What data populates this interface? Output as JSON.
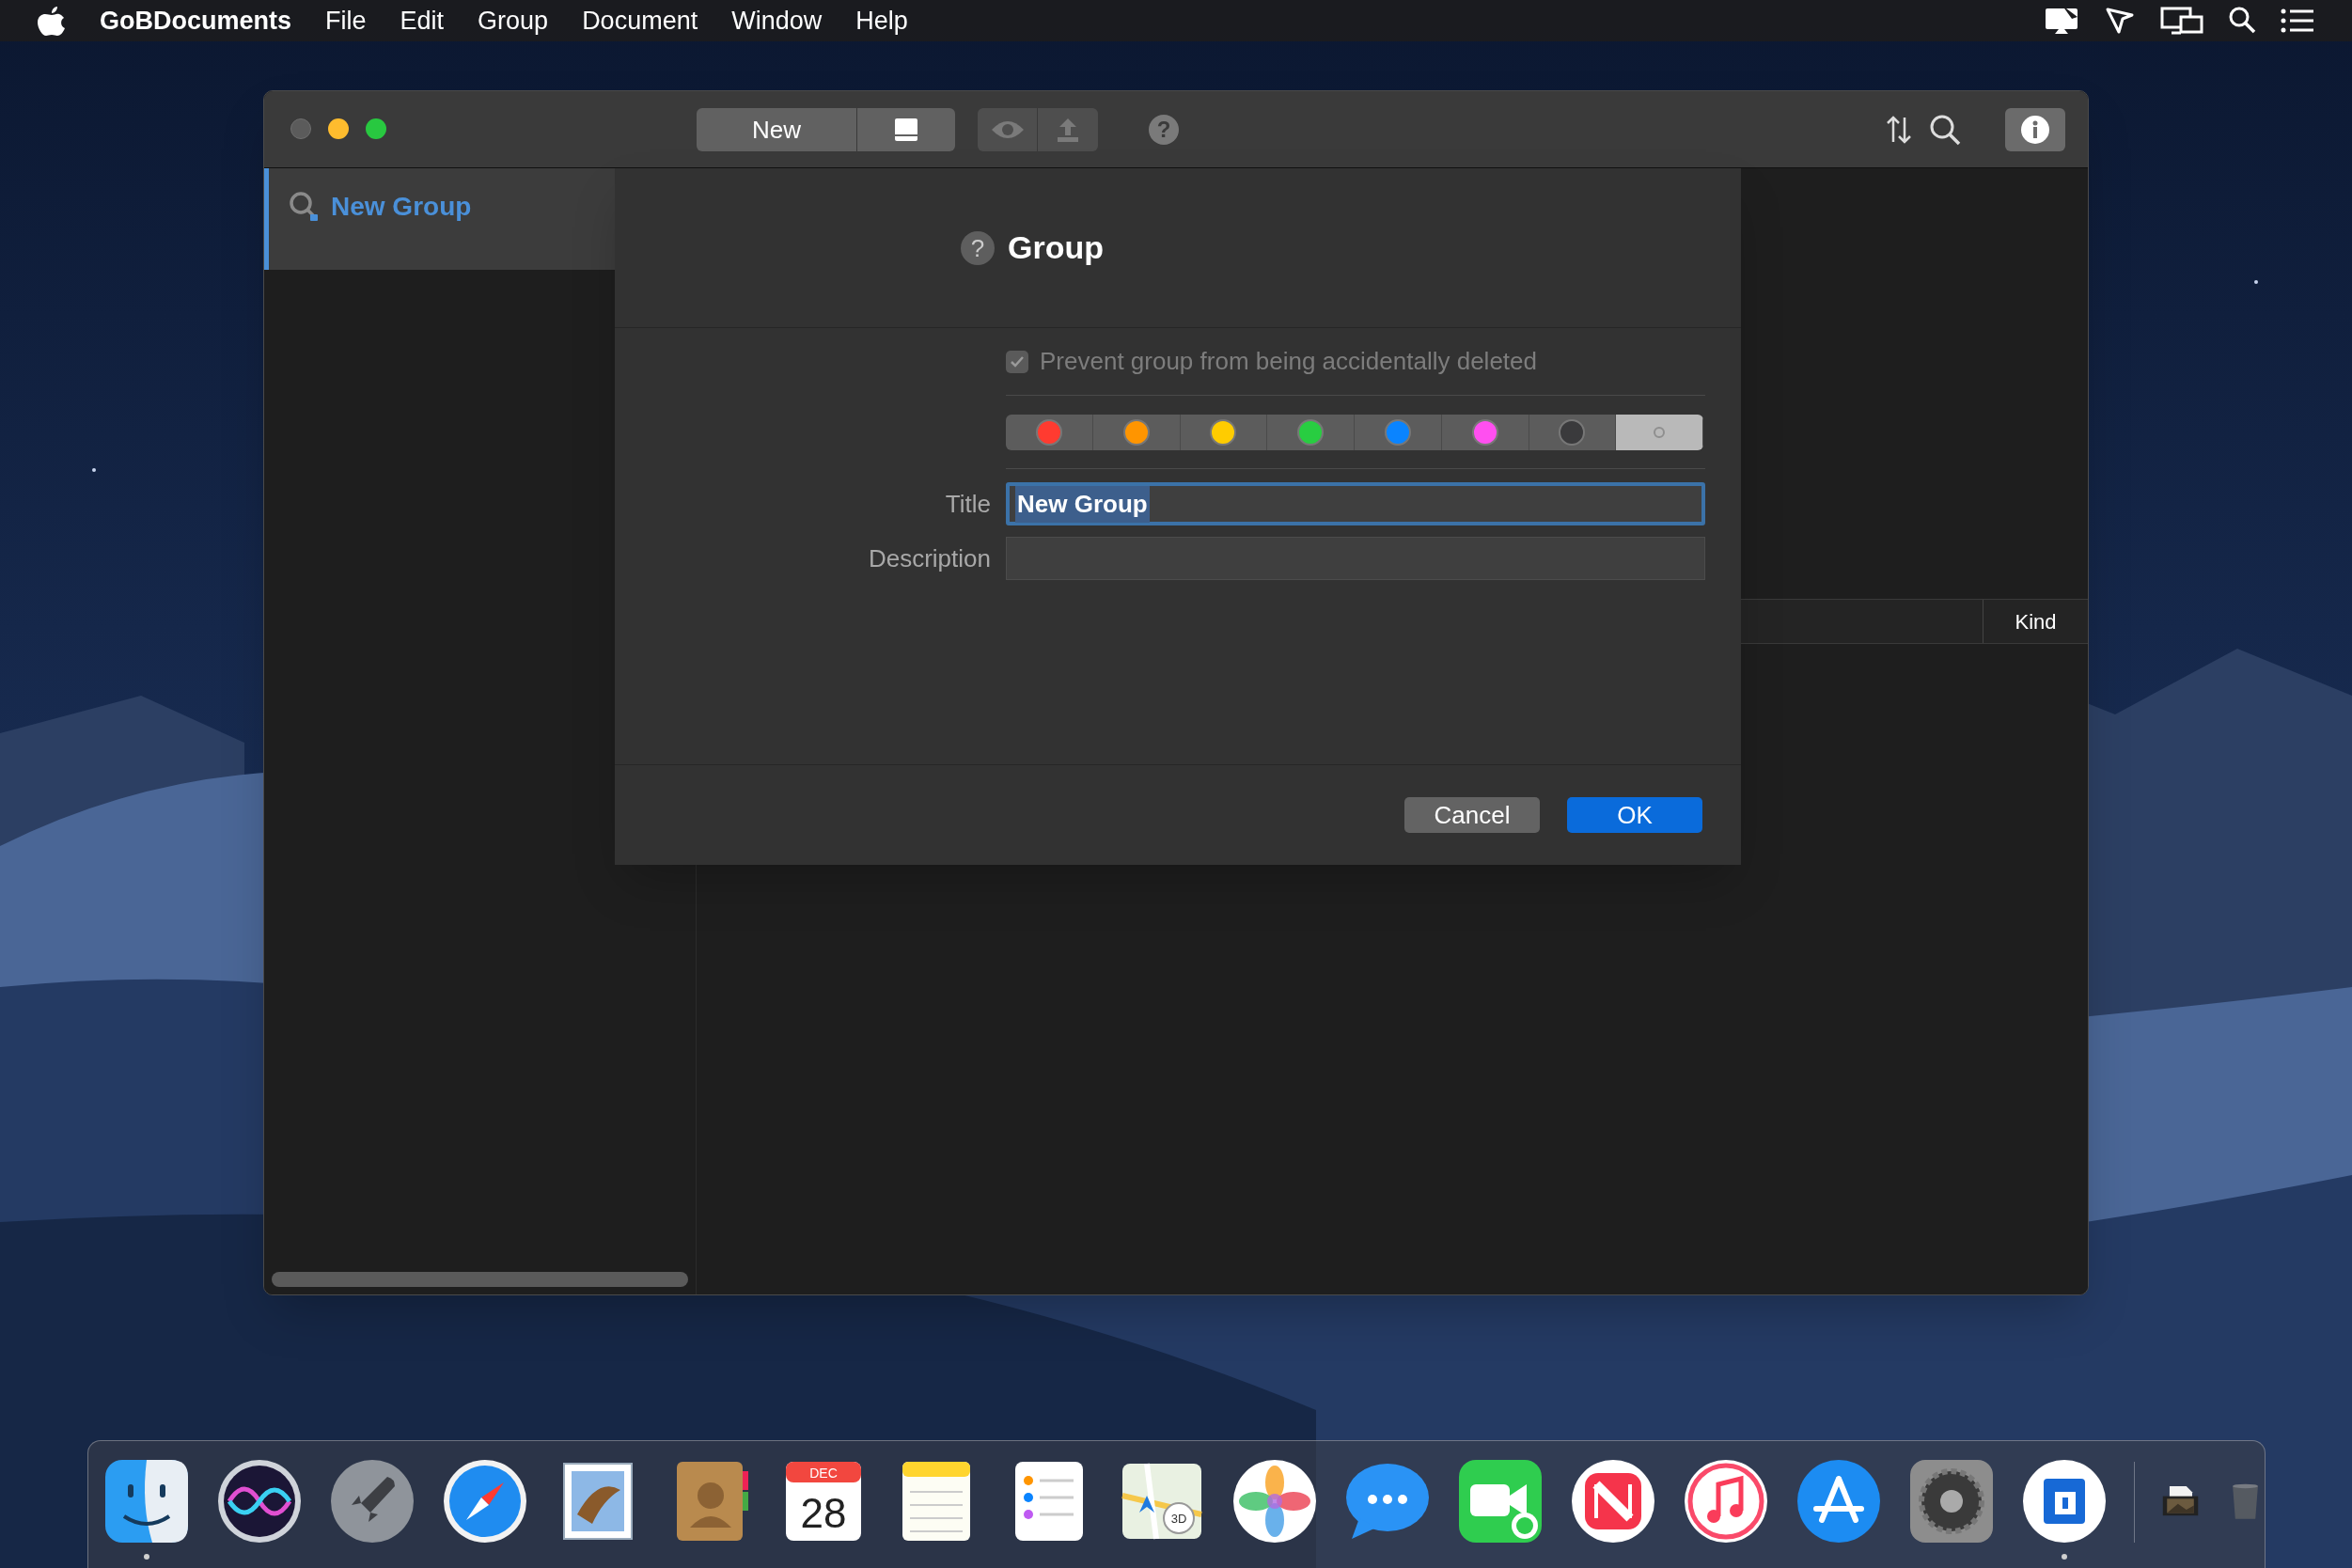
{
  "menu_bar": {
    "app_name": "GoBDocuments",
    "menus": [
      "File",
      "Edit",
      "Group",
      "Document",
      "Window",
      "Help"
    ]
  },
  "window": {
    "traffic_lights": [
      {
        "kind": "close",
        "disabled": true
      },
      {
        "kind": "minimize",
        "disabled": false
      },
      {
        "kind": "zoom",
        "disabled": false
      }
    ],
    "toolbar": {
      "new_button": "New",
      "help_button": "?",
      "info_button": {
        "selected": true
      }
    },
    "sidebar": {
      "items": [
        {
          "label": "New Group",
          "selected": true
        }
      ]
    },
    "table": {
      "columns": [
        "Kind"
      ]
    }
  },
  "dialog": {
    "help": "?",
    "title": "Group",
    "protect": {
      "label": "Prevent group from being accidentally deleted",
      "checked": true,
      "disabled": true
    },
    "colors": [
      {
        "kind": "color",
        "color": "#ff3b30",
        "selected": false
      },
      {
        "kind": "color",
        "color": "#ff9500",
        "selected": false
      },
      {
        "kind": "color",
        "color": "#ffcc00",
        "selected": false
      },
      {
        "kind": "color",
        "color": "#28cd41",
        "selected": false
      },
      {
        "kind": "color",
        "color": "#0a84ff",
        "selected": false
      },
      {
        "kind": "color",
        "color": "#ff4ff0",
        "selected": false
      },
      {
        "kind": "color",
        "color": "#3a3a3c",
        "selected": false
      },
      {
        "kind": "none",
        "selected": true
      }
    ],
    "fields": [
      {
        "label": "Title",
        "value": "New Group",
        "focused": true
      },
      {
        "label": "Description",
        "focused": false
      }
    ],
    "buttons": [
      {
        "label": "Cancel",
        "kind": "secondary"
      },
      {
        "label": "OK",
        "kind": "default"
      }
    ]
  },
  "dock": {
    "apps": [
      {
        "kind": "finder",
        "running": true
      },
      {
        "kind": "siri",
        "running": false
      },
      {
        "kind": "launchpad",
        "running": false
      },
      {
        "kind": "safari",
        "running": false
      },
      {
        "kind": "mail",
        "running": false
      },
      {
        "kind": "contacts",
        "running": false
      },
      {
        "kind": "calendar",
        "month": "DEC",
        "day": "28",
        "running": false
      },
      {
        "kind": "notes",
        "running": false
      },
      {
        "kind": "reminders",
        "running": false
      },
      {
        "kind": "maps",
        "badge": "3D",
        "running": false
      },
      {
        "kind": "photos",
        "running": false
      },
      {
        "kind": "messages",
        "running": false
      },
      {
        "kind": "facetime",
        "running": false
      },
      {
        "kind": "news",
        "running": false
      },
      {
        "kind": "music",
        "running": false
      },
      {
        "kind": "appstore",
        "running": false
      },
      {
        "kind": "preferences",
        "running": false
      },
      {
        "kind": "gobdocs",
        "running": true
      }
    ],
    "others": [
      {
        "kind": "stack"
      },
      {
        "kind": "trash"
      }
    ]
  }
}
